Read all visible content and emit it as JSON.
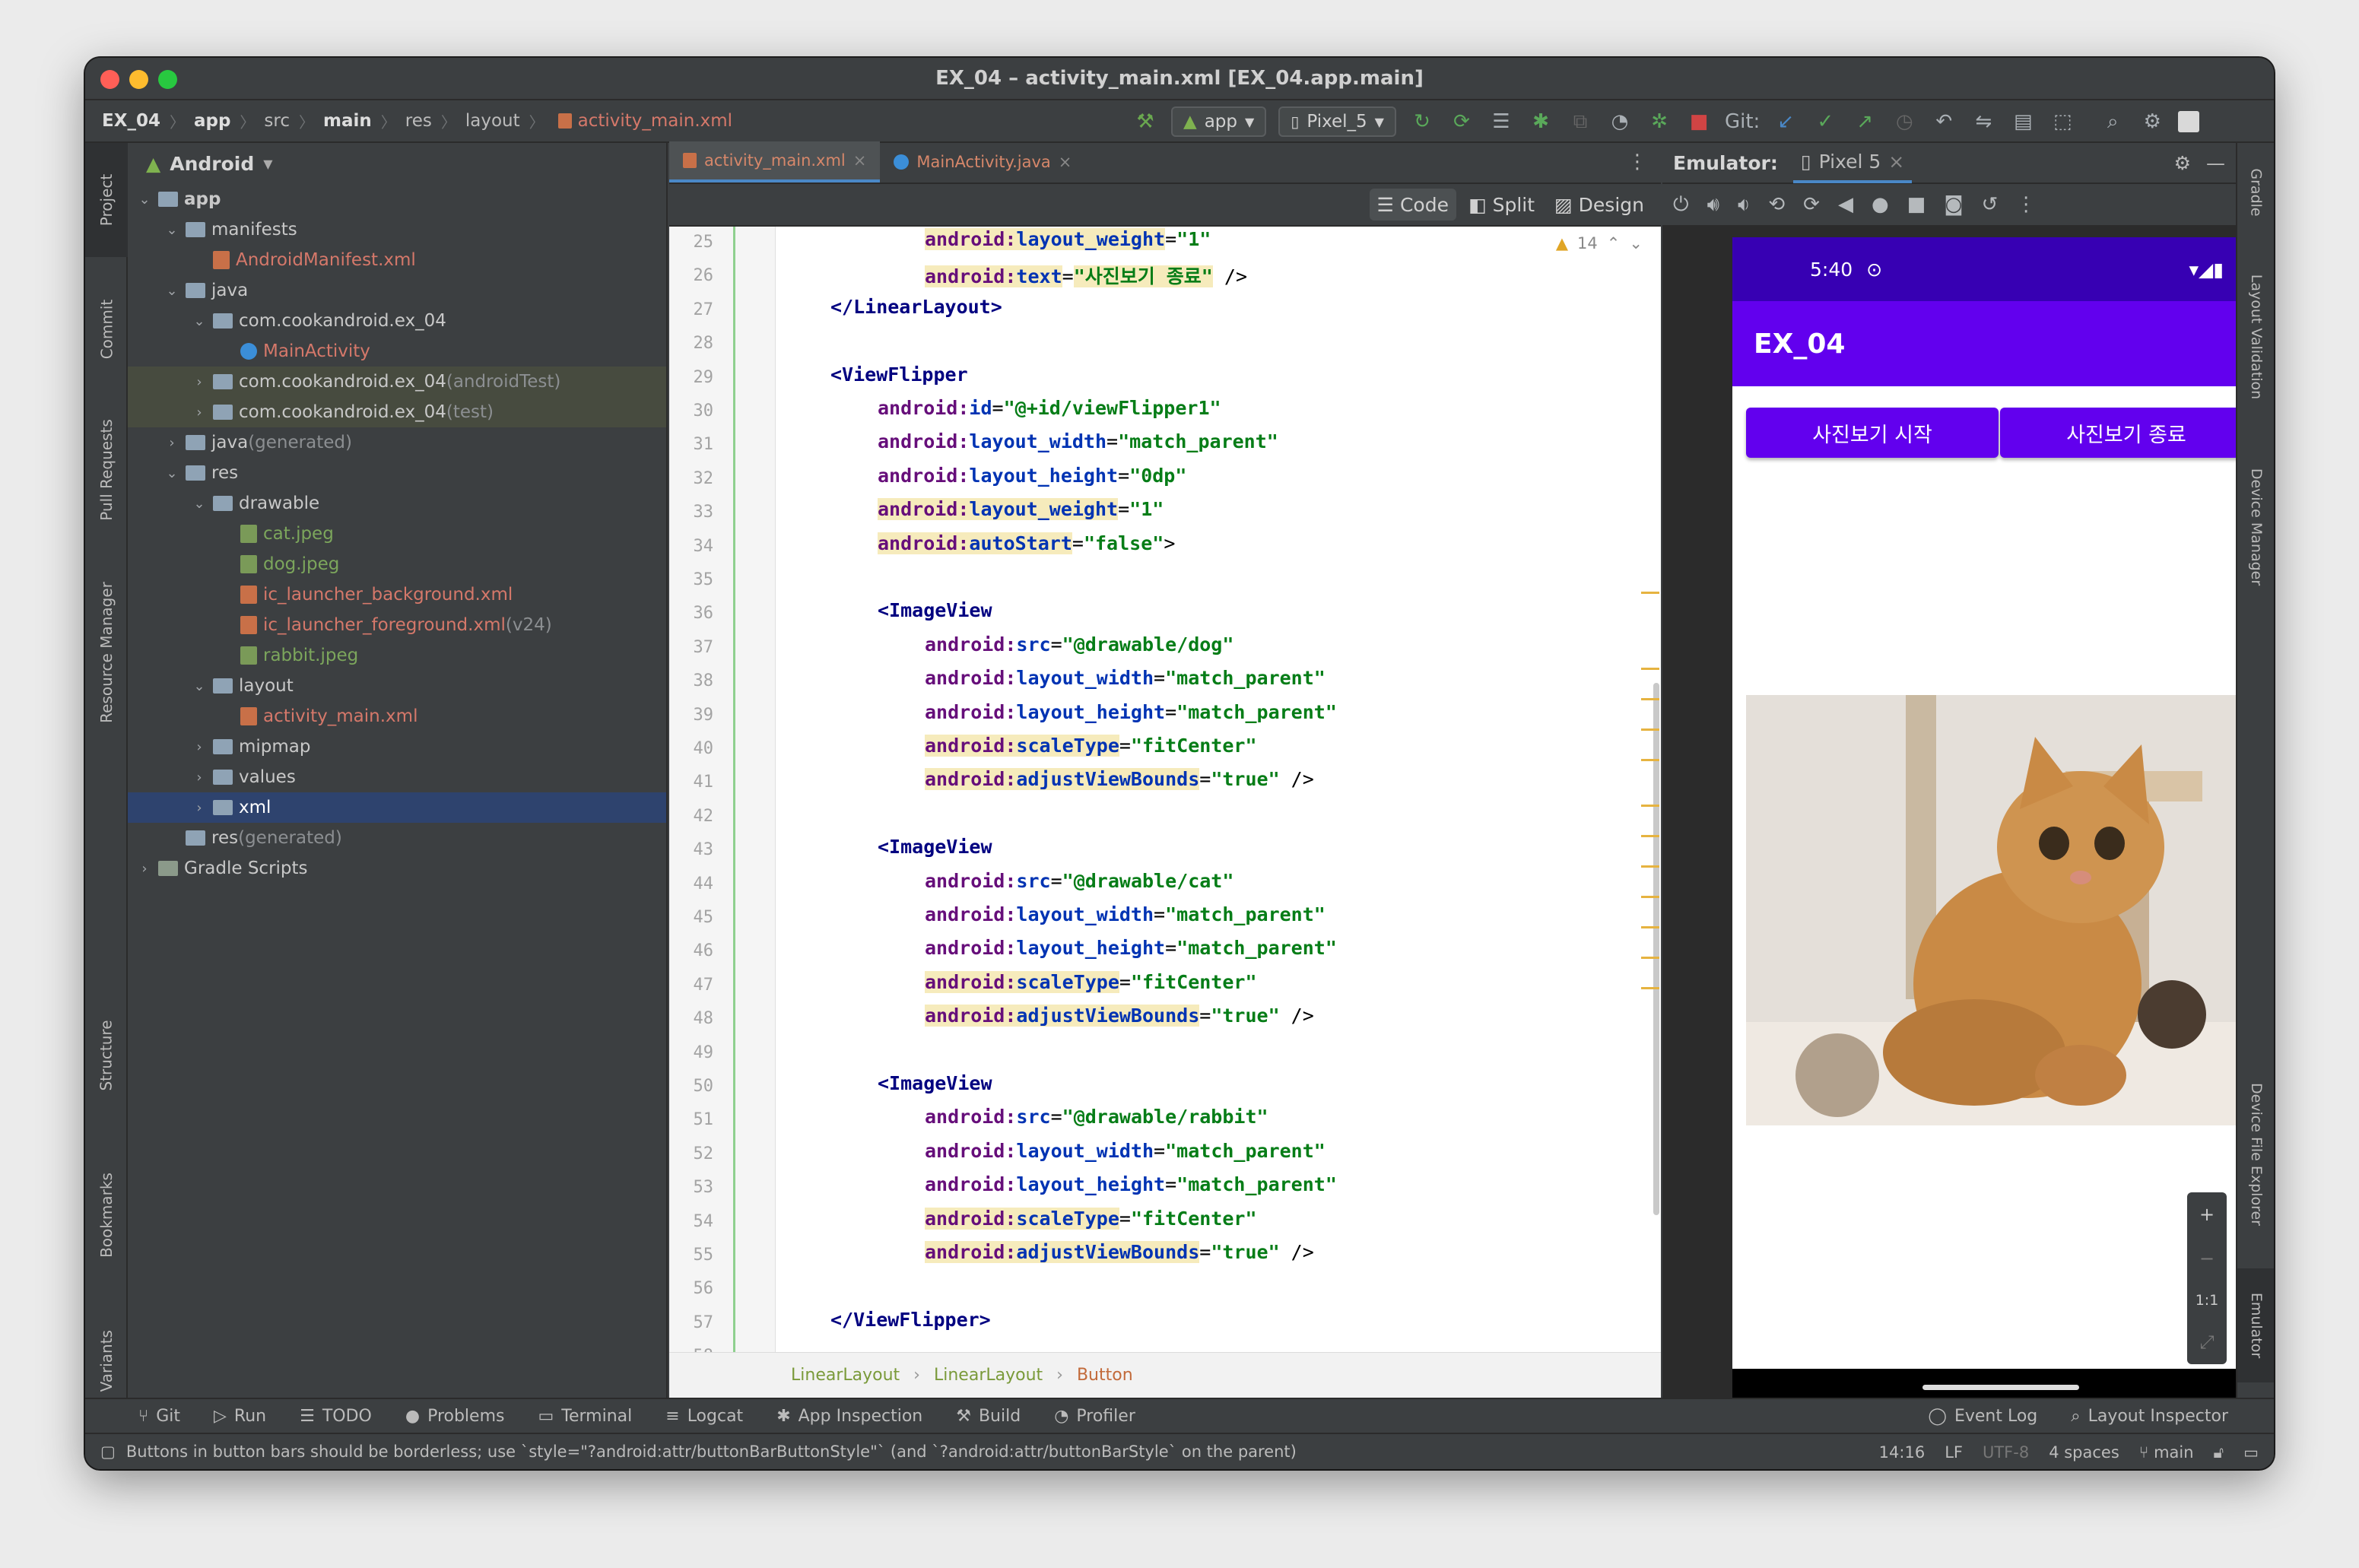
{
  "window": {
    "title": "EX_04 – activity_main.xml [EX_04.app.main]"
  },
  "breadcrumb": [
    "EX_04",
    "app",
    "src",
    "main",
    "res",
    "layout",
    "activity_main.xml"
  ],
  "toolbar": {
    "run_config": "app",
    "device": "Pixel_5",
    "git_label": "Git:"
  },
  "left_tabs": [
    "Project",
    "Commit",
    "Pull Requests",
    "Resource Manager",
    "Structure",
    "Bookmarks",
    "Build Variants"
  ],
  "right_tabs": [
    "Gradle",
    "Layout Validation",
    "Device Manager",
    "Device File Explorer",
    "Emulator"
  ],
  "project": {
    "view": "Android",
    "tree": [
      {
        "label": "app",
        "suffix": ""
      },
      {
        "label": "manifests",
        "suffix": ""
      },
      {
        "label": "AndroidManifest.xml",
        "suffix": ""
      },
      {
        "label": "java",
        "suffix": ""
      },
      {
        "label": "com.cookandroid.ex_04",
        "suffix": ""
      },
      {
        "label": "MainActivity",
        "suffix": ""
      },
      {
        "label": "com.cookandroid.ex_04",
        "suffix": " (androidTest)"
      },
      {
        "label": "com.cookandroid.ex_04",
        "suffix": " (test)"
      },
      {
        "label": "java",
        "suffix": " (generated)"
      },
      {
        "label": "res",
        "suffix": ""
      },
      {
        "label": "drawable",
        "suffix": ""
      },
      {
        "label": "cat.jpeg",
        "suffix": ""
      },
      {
        "label": "dog.jpeg",
        "suffix": ""
      },
      {
        "label": "ic_launcher_background.xml",
        "suffix": ""
      },
      {
        "label": "ic_launcher_foreground.xml",
        "suffix": " (v24)"
      },
      {
        "label": "rabbit.jpeg",
        "suffix": ""
      },
      {
        "label": "layout",
        "suffix": ""
      },
      {
        "label": "activity_main.xml",
        "suffix": ""
      },
      {
        "label": "mipmap",
        "suffix": ""
      },
      {
        "label": "values",
        "suffix": ""
      },
      {
        "label": "xml",
        "suffix": ""
      },
      {
        "label": "res",
        "suffix": " (generated)"
      },
      {
        "label": "Gradle Scripts",
        "suffix": ""
      }
    ]
  },
  "editor": {
    "tabs": [
      "activity_main.xml",
      "MainActivity.java"
    ],
    "view_modes": [
      "Code",
      "Split",
      "Design"
    ],
    "warnings": "14",
    "lines": [
      {
        "n": "25",
        "t": "android:layout_weight=\"1\""
      },
      {
        "n": "26",
        "t": "android:text=\"사진보기 종료\" />"
      },
      {
        "n": "27",
        "t": "</LinearLayout>"
      },
      {
        "n": "28",
        "t": ""
      },
      {
        "n": "29",
        "t": "<ViewFlipper"
      },
      {
        "n": "30",
        "t": "android:id=\"@+id/viewFlipper1\""
      },
      {
        "n": "31",
        "t": "android:layout_width=\"match_parent\""
      },
      {
        "n": "32",
        "t": "android:layout_height=\"0dp\""
      },
      {
        "n": "33",
        "t": "android:layout_weight=\"1\""
      },
      {
        "n": "34",
        "t": "android:autoStart=\"false\">"
      },
      {
        "n": "35",
        "t": ""
      },
      {
        "n": "36",
        "t": "<ImageView"
      },
      {
        "n": "37",
        "t": "android:src=\"@drawable/dog\""
      },
      {
        "n": "38",
        "t": "android:layout_width=\"match_parent\""
      },
      {
        "n": "39",
        "t": "android:layout_height=\"match_parent\""
      },
      {
        "n": "40",
        "t": "android:scaleType=\"fitCenter\""
      },
      {
        "n": "41",
        "t": "android:adjustViewBounds=\"true\" />"
      },
      {
        "n": "42",
        "t": ""
      },
      {
        "n": "43",
        "t": "<ImageView"
      },
      {
        "n": "44",
        "t": "android:src=\"@drawable/cat\""
      },
      {
        "n": "45",
        "t": "android:layout_width=\"match_parent\""
      },
      {
        "n": "46",
        "t": "android:layout_height=\"match_parent\""
      },
      {
        "n": "47",
        "t": "android:scaleType=\"fitCenter\""
      },
      {
        "n": "48",
        "t": "android:adjustViewBounds=\"true\" />"
      },
      {
        "n": "49",
        "t": ""
      },
      {
        "n": "50",
        "t": "<ImageView"
      },
      {
        "n": "51",
        "t": "android:src=\"@drawable/rabbit\""
      },
      {
        "n": "52",
        "t": "android:layout_width=\"match_parent\""
      },
      {
        "n": "53",
        "t": "android:layout_height=\"match_parent\""
      },
      {
        "n": "54",
        "t": "android:scaleType=\"fitCenter\""
      },
      {
        "n": "55",
        "t": "android:adjustViewBounds=\"true\" />"
      },
      {
        "n": "56",
        "t": ""
      },
      {
        "n": "57",
        "t": "</ViewFlipper>"
      },
      {
        "n": "58",
        "t": ""
      }
    ],
    "breadcrumbs": [
      "LinearLayout",
      "LinearLayout",
      "Button"
    ]
  },
  "emulator": {
    "label": "Emulator:",
    "device_tab": "Pixel 5",
    "phone": {
      "time": "5:40",
      "app_title": "EX_04",
      "button_start": "사진보기 시작",
      "button_stop": "사진보기 종료"
    },
    "zoom_label": "1:1"
  },
  "bottom_tools": [
    "Git",
    "Run",
    "TODO",
    "Problems",
    "Terminal",
    "Logcat",
    "App Inspection",
    "Build",
    "Profiler",
    "Event Log",
    "Layout Inspector"
  ],
  "statusbar": {
    "message": "Buttons in button bars should be borderless; use `style=\"?android:attr/buttonBarButtonStyle\"` (and `?android:attr/buttonBarStyle` on the parent)",
    "position": "14:16",
    "line_sep": "LF",
    "encoding": "UTF-8",
    "indent": "4 spaces",
    "branch": "main"
  },
  "colors": {
    "accent_purple": "#6200ee",
    "status_purple": "#3700b3",
    "selection": "#2e436e"
  }
}
